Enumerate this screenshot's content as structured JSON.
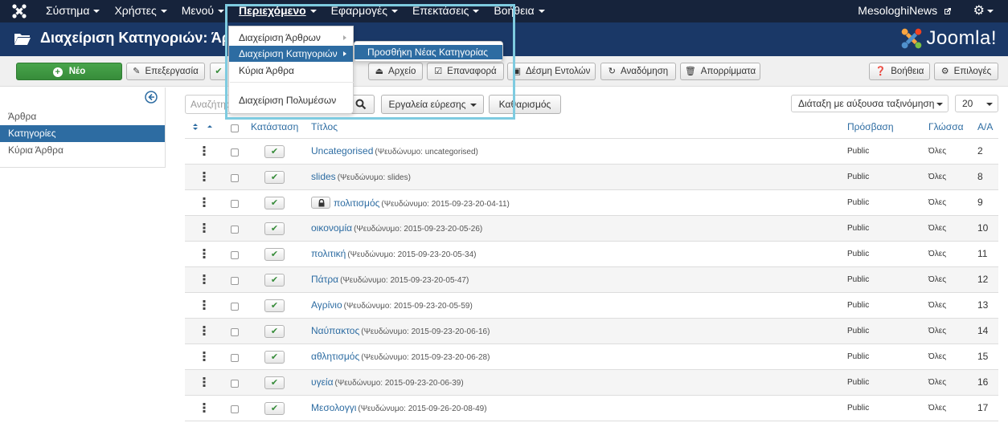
{
  "topnav": {
    "menu": [
      {
        "label": "Σύστημα"
      },
      {
        "label": "Χρήστες"
      },
      {
        "label": "Μενού"
      },
      {
        "label": "Περιεχόμενο"
      },
      {
        "label": "Εφαρμογές"
      },
      {
        "label": "Επεκτάσεις"
      },
      {
        "label": "Βοήθεια"
      }
    ],
    "site_name": "MesologhiNews"
  },
  "header": {
    "title": "Διαχείριση Κατηγοριών: Άρθρα",
    "logo_text": "Joomla!"
  },
  "toolbar": {
    "new": "Νέο",
    "edit": "Επεξεργασία",
    "archive": "Αρχείο",
    "restore": "Επαναφορά",
    "batch": "Δέσμη Εντολών",
    "rebuild": "Αναδόμηση",
    "trash": "Απορρίμματα",
    "help": "Βοήθεια",
    "options": "Επιλογές"
  },
  "sidebar": {
    "items": [
      {
        "label": "Άρθρα"
      },
      {
        "label": "Κατηγορίες"
      },
      {
        "label": "Κύρια Άρθρα"
      }
    ]
  },
  "filters": {
    "search_placeholder": "Αναζήτηση",
    "tools": "Εργαλεία εύρεσης",
    "clear": "Καθαρισμός",
    "ordering": "Διάταξη με αύξουσα ταξινόμηση",
    "limit": "20"
  },
  "table": {
    "headers": {
      "status": "Κατάσταση",
      "title": "Τίτλος",
      "access": "Πρόσβαση",
      "language": "Γλώσσα",
      "id": "Α/Α"
    },
    "rows": [
      {
        "title": "Uncategorised",
        "alias": "(Ψευδώνυμο: uncategorised)",
        "access": "Public",
        "language": "Όλες",
        "id": "2",
        "locked": false
      },
      {
        "title": "slides",
        "alias": "(Ψευδώνυμο: slides)",
        "access": "Public",
        "language": "Όλες",
        "id": "8",
        "locked": false
      },
      {
        "title": "πολιτισμός",
        "alias": "(Ψευδώνυμο: 2015-09-23-20-04-11)",
        "access": "Public",
        "language": "Όλες",
        "id": "9",
        "locked": true
      },
      {
        "title": "οικονομία",
        "alias": "(Ψευδώνυμο: 2015-09-23-20-05-26)",
        "access": "Public",
        "language": "Όλες",
        "id": "10",
        "locked": false
      },
      {
        "title": "πολιτική",
        "alias": "(Ψευδώνυμο: 2015-09-23-20-05-34)",
        "access": "Public",
        "language": "Όλες",
        "id": "11",
        "locked": false
      },
      {
        "title": "Πάτρα",
        "alias": "(Ψευδώνυμο: 2015-09-23-20-05-47)",
        "access": "Public",
        "language": "Όλες",
        "id": "12",
        "locked": false
      },
      {
        "title": "Αγρίνιο",
        "alias": "(Ψευδώνυμο: 2015-09-23-20-05-59)",
        "access": "Public",
        "language": "Όλες",
        "id": "13",
        "locked": false
      },
      {
        "title": "Ναύπακτος",
        "alias": "(Ψευδώνυμο: 2015-09-23-20-06-16)",
        "access": "Public",
        "language": "Όλες",
        "id": "14",
        "locked": false
      },
      {
        "title": "αθλητισμός",
        "alias": "(Ψευδώνυμο: 2015-09-23-20-06-28)",
        "access": "Public",
        "language": "Όλες",
        "id": "15",
        "locked": false
      },
      {
        "title": "υγεία",
        "alias": "(Ψευδώνυμο: 2015-09-23-20-06-39)",
        "access": "Public",
        "language": "Όλες",
        "id": "16",
        "locked": false
      },
      {
        "title": "Μεσολογγι",
        "alias": "(Ψευδώνυμο: 2015-09-26-20-08-49)",
        "access": "Public",
        "language": "Όλες",
        "id": "17",
        "locked": false
      }
    ]
  },
  "dropdown": {
    "items": [
      {
        "label": "Διαχείριση Άρθρων"
      },
      {
        "label": "Διαχείριση Κατηγοριών"
      },
      {
        "label": "Κύρια Άρθρα"
      },
      {
        "label": "Διαχείριση Πολυμέσων"
      }
    ],
    "submenu": {
      "label": "Προσθήκη Νέας Κατηγορίας"
    }
  },
  "colors": {
    "topnav": "#16233b",
    "header": "#1a3867",
    "link": "#2d6ca2",
    "new_button": "#3f9a42",
    "highlight": "#7ecbe0"
  }
}
